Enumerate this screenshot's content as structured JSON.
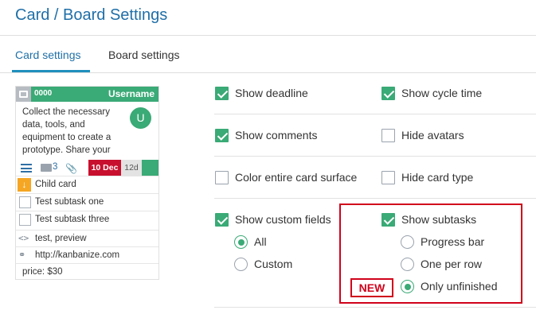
{
  "header": {
    "title": "Card / Board Settings"
  },
  "tabs": [
    {
      "label": "Card settings",
      "active": true
    },
    {
      "label": "Board settings",
      "active": false
    }
  ],
  "card_preview": {
    "id": "0000",
    "username": "Username",
    "description_lines": [
      "Collect the necessary",
      "data, tools, and",
      "equipment to create a",
      "prototype. Share your"
    ],
    "avatar_letter": "U",
    "comment_count": "3",
    "deadline": "10 Dec",
    "cycle_time": "12d",
    "child_card": "Child card",
    "subtasks": [
      "Test subtask one",
      "Test subtask three"
    ],
    "custom_field_text": "test, preview",
    "custom_field_link": "http://kanbanize.com",
    "price": "price: $30",
    "colors": {
      "header": "#3aaa76",
      "deadline": "#c8102e",
      "child": "#f5a623"
    }
  },
  "options": {
    "show_deadline": {
      "label": "Show deadline",
      "checked": true
    },
    "show_cycle_time": {
      "label": "Show cycle time",
      "checked": true
    },
    "show_comments": {
      "label": "Show comments",
      "checked": true
    },
    "hide_avatars": {
      "label": "Hide avatars",
      "checked": false
    },
    "color_surface": {
      "label": "Color entire card surface",
      "checked": false
    },
    "hide_card_type": {
      "label": "Hide card type",
      "checked": false
    },
    "show_custom_fields": {
      "label": "Show custom fields",
      "checked": true,
      "choices": [
        {
          "label": "All",
          "selected": true
        },
        {
          "label": "Custom",
          "selected": false
        }
      ]
    },
    "show_subtasks": {
      "label": "Show subtasks",
      "checked": true,
      "choices": [
        {
          "label": "Progress bar",
          "selected": false
        },
        {
          "label": "One per row",
          "selected": false
        },
        {
          "label": "Only unfinished",
          "selected": true
        }
      ]
    }
  },
  "new_badge": "NEW",
  "accent_color": "#3aaa76"
}
